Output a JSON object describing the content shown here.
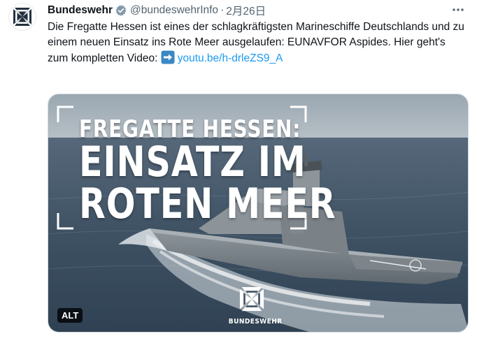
{
  "tweet": {
    "author": {
      "display_name": "Bundeswehr",
      "handle": "@bundeswehrInfo",
      "verified_icon": "verified-badge-icon"
    },
    "separator": "·",
    "date": "2月26日",
    "more_icon": "more-horizontal-icon",
    "text": {
      "body": "Die Fregatte Hessen ist eines der schlagkräftigsten Marineschiffe Deutschlands und zu einem neuen Einsatz ins Rote Meer ausgelaufen: EUNAVFOR Aspides. Hier geht's zum kompletten Video: ",
      "emoji_icon": "right-arrow-emoji-icon",
      "link": "youtu.be/h-drleZS9_A"
    },
    "media": {
      "headline_line1": "FREGATTE HESSEN:",
      "headline_line2": "EINSATZ IM",
      "headline_line3": "ROTEN MEER",
      "logo_word": "BUNDESWEHR",
      "alt_badge": "ALT"
    }
  },
  "colors": {
    "text": "#0f1419",
    "secondary": "#536471",
    "link": "#1d9bf0",
    "verified": "#829aab",
    "sea": "#3d5264",
    "sky": "#aeb8bf"
  }
}
